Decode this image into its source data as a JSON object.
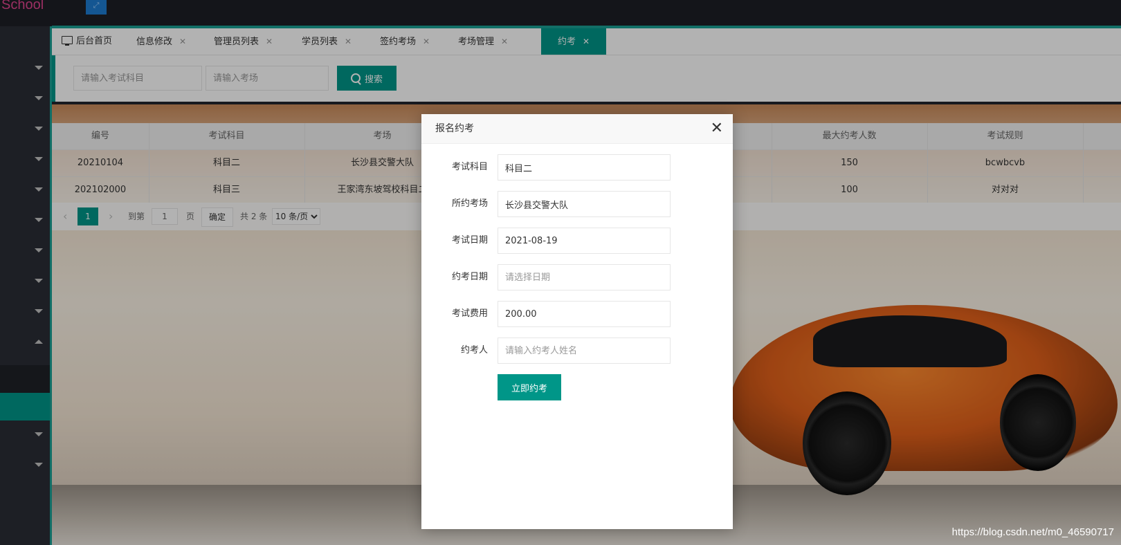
{
  "app": {
    "brand": "School",
    "top_icon": "expand-icon"
  },
  "sidebar": {
    "item_count": 12
  },
  "tabs": [
    {
      "label": "后台首页",
      "closable": false
    },
    {
      "label": "信息修改",
      "closable": true
    },
    {
      "label": "管理员列表",
      "closable": true
    },
    {
      "label": "学员列表",
      "closable": true
    },
    {
      "label": "签约考场",
      "closable": true
    },
    {
      "label": "考场管理",
      "closable": true
    },
    {
      "label": "约考",
      "closable": true,
      "active": true
    }
  ],
  "tab_close_glyph": "✕",
  "search": {
    "subject_placeholder": "请输入考试科目",
    "venue_placeholder": "请输入考场",
    "button_label": "搜索"
  },
  "table": {
    "headers": [
      "编号",
      "考试科目",
      "考场",
      "",
      "",
      "最大约考人数",
      "考试规则"
    ],
    "rows": [
      [
        "20210104",
        "科目二",
        "长沙县交警大队",
        "",
        "",
        "150",
        "bcwbcvb"
      ],
      [
        "202102000",
        "科目三",
        "王家湾东坡驾校科目二",
        "",
        "",
        "100",
        "对对对"
      ]
    ]
  },
  "pager": {
    "prev": "‹",
    "current": "1",
    "next": "›",
    "goto_label": "到第",
    "goto_value": "1",
    "page_label": "页",
    "confirm": "确定",
    "total": "共 2 条",
    "per_page": "10 条/页"
  },
  "modal": {
    "title": "报名约考",
    "close": "✕",
    "fields": [
      {
        "label": "考试科目",
        "value": "科目二",
        "placeholder": ""
      },
      {
        "label": "所约考场",
        "value": "长沙县交警大队",
        "placeholder": ""
      },
      {
        "label": "考试日期",
        "value": "2021-08-19",
        "placeholder": ""
      },
      {
        "label": "约考日期",
        "value": "",
        "placeholder": "请选择日期"
      },
      {
        "label": "考试费用",
        "value": "200.00",
        "placeholder": ""
      },
      {
        "label": "约考人",
        "value": "",
        "placeholder": "请输入约考人姓名"
      }
    ],
    "submit": "立即约考"
  },
  "watermark": "https://blog.csdn.net/m0_46590717",
  "colors": {
    "accent": "#009688",
    "brand": "#e0448e",
    "topbar": "#1d1f26",
    "sidebar": "#2a2d35"
  }
}
